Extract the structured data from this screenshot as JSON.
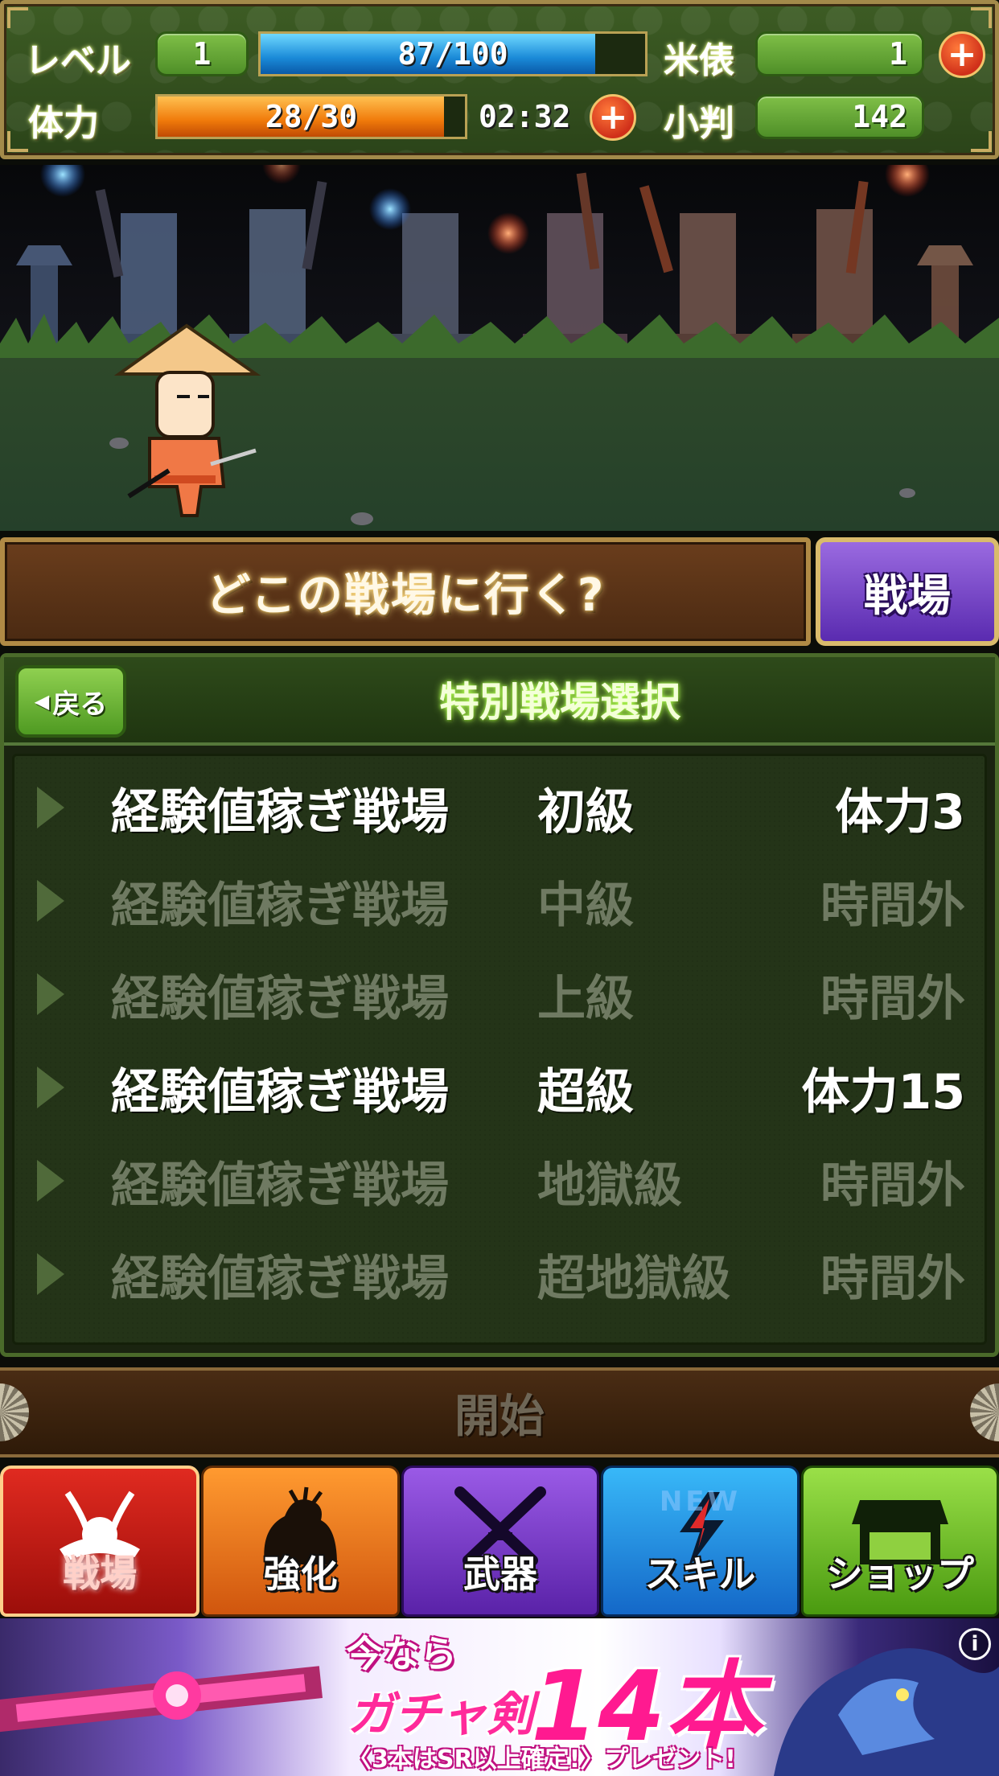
{
  "status": {
    "level_label": "レベル",
    "level_value": "1",
    "exp_text": "87/100",
    "exp_fraction": 0.87,
    "rice_label": "米俵",
    "rice_value": "1",
    "stamina_label": "体力",
    "stamina_text": "28/30",
    "stamina_fraction": 0.933,
    "timer": "02:32",
    "koban_label": "小判",
    "koban_value": "142",
    "plus_symbol": "+"
  },
  "question": {
    "text": "どこの戦場に行く?",
    "button_label": "戦場"
  },
  "panel": {
    "back_label": "戻る",
    "title": "特別戦場選択",
    "stages": [
      {
        "name": "経験値稼ぎ戦場",
        "rank": "初級",
        "cost": "体力3",
        "active": true
      },
      {
        "name": "経験値稼ぎ戦場",
        "rank": "中級",
        "cost": "時間外",
        "active": false
      },
      {
        "name": "経験値稼ぎ戦場",
        "rank": "上級",
        "cost": "時間外",
        "active": false
      },
      {
        "name": "経験値稼ぎ戦場",
        "rank": "超級",
        "cost": "体力15",
        "active": true
      },
      {
        "name": "経験値稼ぎ戦場",
        "rank": "地獄級",
        "cost": "時間外",
        "active": false
      },
      {
        "name": "経験値稼ぎ戦場",
        "rank": "超地獄級",
        "cost": "時間外",
        "active": false
      }
    ]
  },
  "start": {
    "label": "開始"
  },
  "tabs": [
    {
      "key": "battle",
      "label": "戦場",
      "icon": "helmet-icon"
    },
    {
      "key": "power",
      "label": "強化",
      "icon": "flex-arm-icon"
    },
    {
      "key": "weapon",
      "label": "武器",
      "icon": "crossed-swords-icon"
    },
    {
      "key": "skill",
      "label": "スキル",
      "icon": "lightning-icon",
      "badge": "NEW"
    },
    {
      "key": "shop",
      "label": "ショップ",
      "icon": "shop-stall-icon"
    }
  ],
  "ad": {
    "line1": "今なら",
    "line2": "ガチャ剣",
    "big": "14本",
    "line3": "〈3本はSR以上確定!〉プレゼント!",
    "info": "i"
  },
  "colors": {
    "exp_bar": "#1aa8f0",
    "stamina_bar": "#f28a10",
    "active_text": "#ffffff",
    "inactive_text": "#6f7a62"
  }
}
